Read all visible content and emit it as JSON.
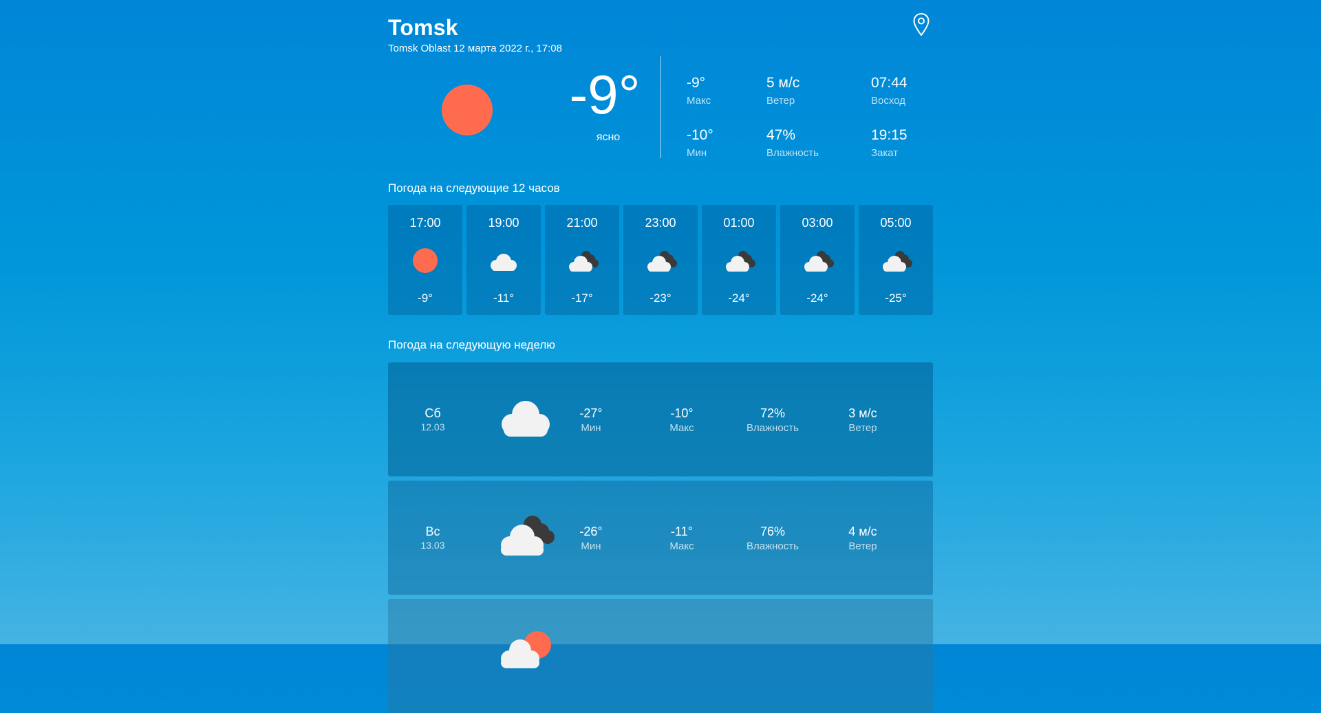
{
  "header": {
    "city": "Tomsk",
    "subtitle": "Tomsk Oblast 12 марта 2022 г., 17:08",
    "location_icon": "map-pin-icon"
  },
  "current": {
    "icon": "sun-icon",
    "temp": "-9°",
    "condition": "ясно",
    "stats": [
      {
        "value": "-9°",
        "label": "Макс"
      },
      {
        "value": "5 м/с",
        "label": "Ветер"
      },
      {
        "value": "07:44",
        "label": "Восход"
      },
      {
        "value": "-10°",
        "label": "Мин"
      },
      {
        "value": "47%",
        "label": "Влажность"
      },
      {
        "value": "19:15",
        "label": "Закат"
      }
    ]
  },
  "hourly": {
    "title": "Погода на следующие 12 часов",
    "items": [
      {
        "time": "17:00",
        "icon": "sun-icon",
        "temp": "-9°"
      },
      {
        "time": "19:00",
        "icon": "cloud-icon",
        "temp": "-11°"
      },
      {
        "time": "21:00",
        "icon": "overcast-icon",
        "temp": "-17°"
      },
      {
        "time": "23:00",
        "icon": "overcast-icon",
        "temp": "-23°"
      },
      {
        "time": "01:00",
        "icon": "overcast-icon",
        "temp": "-24°"
      },
      {
        "time": "03:00",
        "icon": "overcast-icon",
        "temp": "-24°"
      },
      {
        "time": "05:00",
        "icon": "overcast-icon",
        "temp": "-25°"
      }
    ]
  },
  "weekly": {
    "title": "Погода на следующую неделю",
    "days": [
      {
        "day": "Сб",
        "date": "12.03",
        "icon": "cloud-icon",
        "min": "-27°",
        "min_label": "Мин",
        "max": "-10°",
        "max_label": "Макс",
        "humidity": "72%",
        "humidity_label": "Влажность",
        "wind": "3 м/с",
        "wind_label": "Ветер"
      },
      {
        "day": "Вс",
        "date": "13.03",
        "icon": "overcast-icon",
        "min": "-26°",
        "min_label": "Мин",
        "max": "-11°",
        "max_label": "Макс",
        "humidity": "76%",
        "humidity_label": "Влажность",
        "wind": "4 м/с",
        "wind_label": "Ветер"
      },
      {
        "day": "",
        "date": "",
        "icon": "partly-sunny-icon"
      }
    ]
  },
  "colors": {
    "sun": "#ff6b4f",
    "cloud": "#f2f2f2",
    "dark_cloud": "#3a3a3a"
  }
}
